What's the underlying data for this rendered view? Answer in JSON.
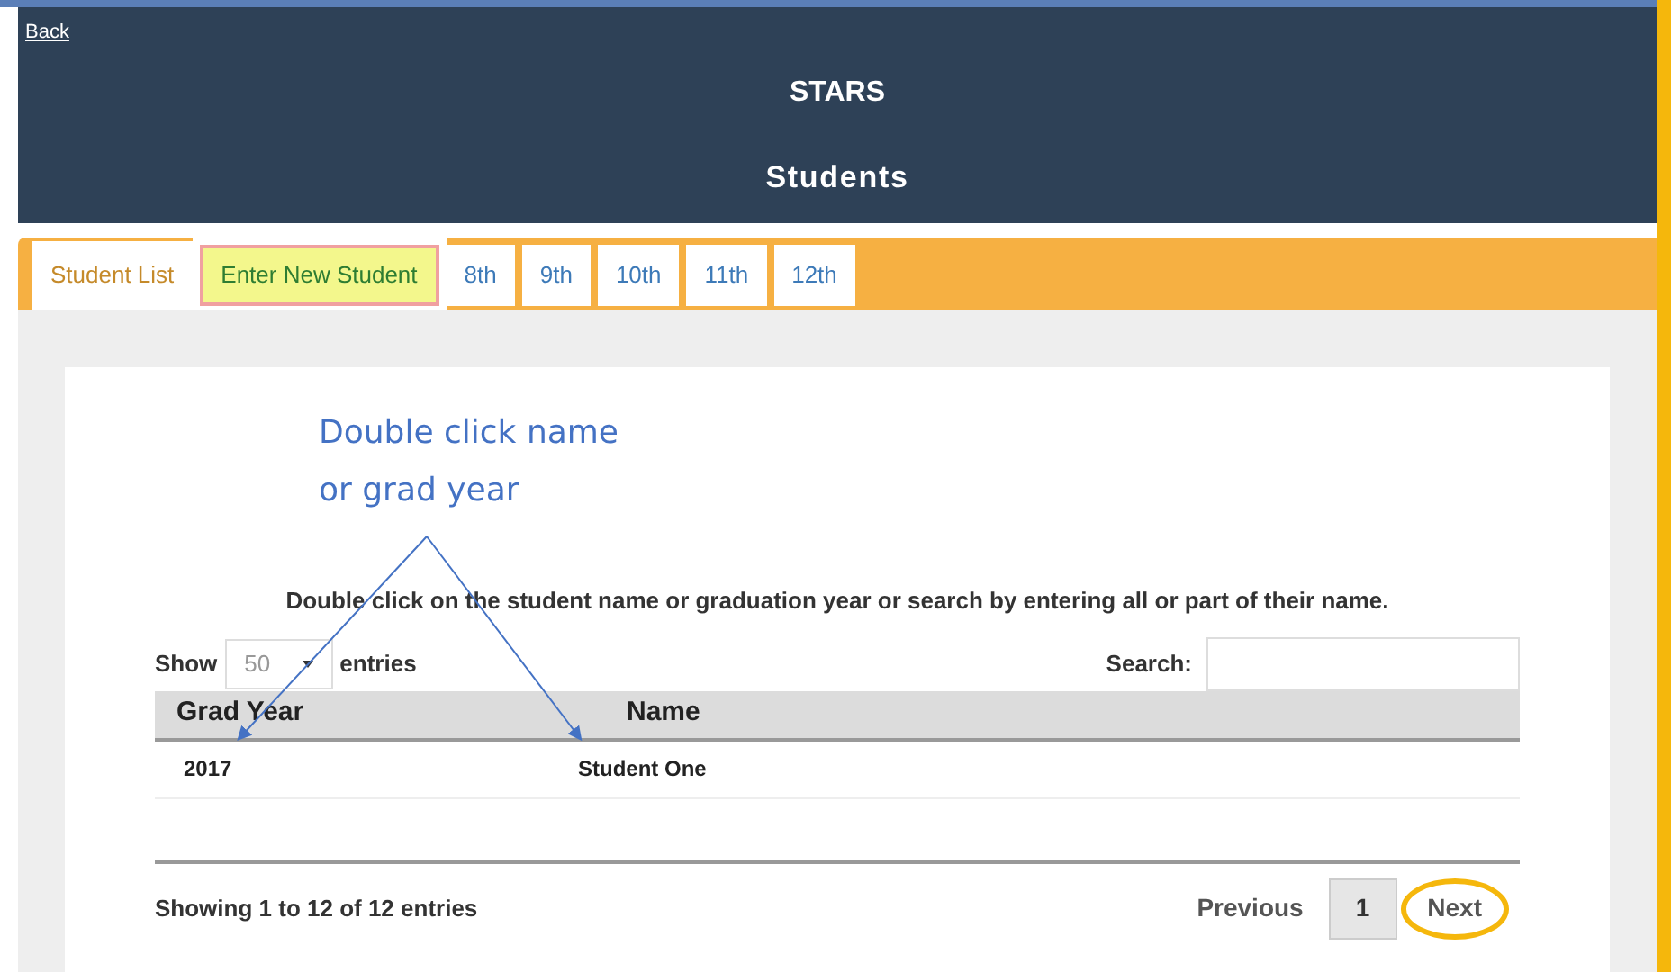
{
  "back_link": "Back",
  "header": {
    "title": "STARS",
    "subtitle": "Students"
  },
  "tabs": [
    {
      "label": "Student List",
      "selected": true,
      "highlighted": false
    },
    {
      "label": "Enter New Student",
      "selected": false,
      "highlighted": true
    },
    {
      "label": "8th",
      "selected": false,
      "highlighted": false
    },
    {
      "label": "9th",
      "selected": false,
      "highlighted": false
    },
    {
      "label": "10th",
      "selected": false,
      "highlighted": false
    },
    {
      "label": "11th",
      "selected": false,
      "highlighted": false
    },
    {
      "label": "12th",
      "selected": false,
      "highlighted": false
    }
  ],
  "callout": {
    "lines": [
      "Double click name",
      "or grad year"
    ]
  },
  "instruction": "Double click on the student name or graduation year or search by entering all or part of their name.",
  "length_control": {
    "before": "Show",
    "value": "50",
    "after": "entries"
  },
  "search": {
    "label": "Search:"
  },
  "table": {
    "columns": [
      "Grad Year",
      "Name"
    ],
    "rows": [
      [
        "2017",
        "Student One"
      ]
    ]
  },
  "info": "Showing 1 to 12 of 12 entries",
  "pagination": [
    {
      "label": "Previous",
      "kind": "link",
      "selected": false,
      "circled": false
    },
    {
      "label": "1",
      "kind": "page",
      "selected": true,
      "circled": false
    },
    {
      "label": "Next",
      "kind": "link",
      "selected": false,
      "circled": true
    }
  ]
}
